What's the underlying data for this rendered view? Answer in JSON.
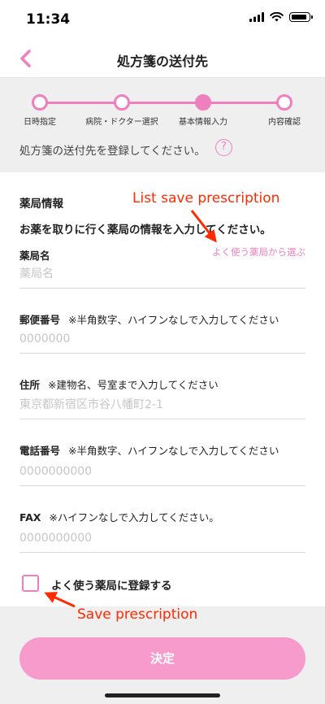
{
  "status_bar": {
    "time": "11:34"
  },
  "nav": {
    "title": "処方箋の送付先"
  },
  "stepper": {
    "steps": [
      {
        "label": "日時指定",
        "active": false
      },
      {
        "label": "病院・ドクター選択",
        "active": false
      },
      {
        "label": "基本情報入力",
        "active": true
      },
      {
        "label": "内容確認",
        "active": false
      }
    ]
  },
  "instruction": "処方箋の送付先を登録してください。",
  "help_icon": "?",
  "form": {
    "section_title": "薬局情報",
    "section_desc": "お薬を取りに行く薬局の情報を入力してください。",
    "favorite_link": "よく使う薬局から選ぶ",
    "fields": {
      "pharmacy_name": {
        "label": "薬局名",
        "note": "",
        "placeholder": "薬局名"
      },
      "postal_code": {
        "label": "郵便番号",
        "note": "※半角数字、ハイフンなしで入力してください",
        "placeholder": "0000000"
      },
      "address": {
        "label": "住所",
        "note": "※建物名、号室まで入力してください",
        "placeholder": "東京都新宿区市谷八幡町2-1"
      },
      "phone": {
        "label": "電話番号",
        "note": "※半角数字、ハイフンなしで入力してください",
        "placeholder": "0000000000"
      },
      "fax": {
        "label": "FAX",
        "note": "※ハイフンなしで入力してください。",
        "placeholder": "0000000000"
      }
    },
    "save_checkbox_label": "よく使う薬局に登録する",
    "save_checked": false
  },
  "submit_label": "決定",
  "annotations": {
    "list_save": "List save prescription",
    "save": "Save prescription"
  },
  "colors": {
    "accent": "#f07fbe",
    "button": "#f79bcd",
    "annotation": "#ff2a00"
  }
}
